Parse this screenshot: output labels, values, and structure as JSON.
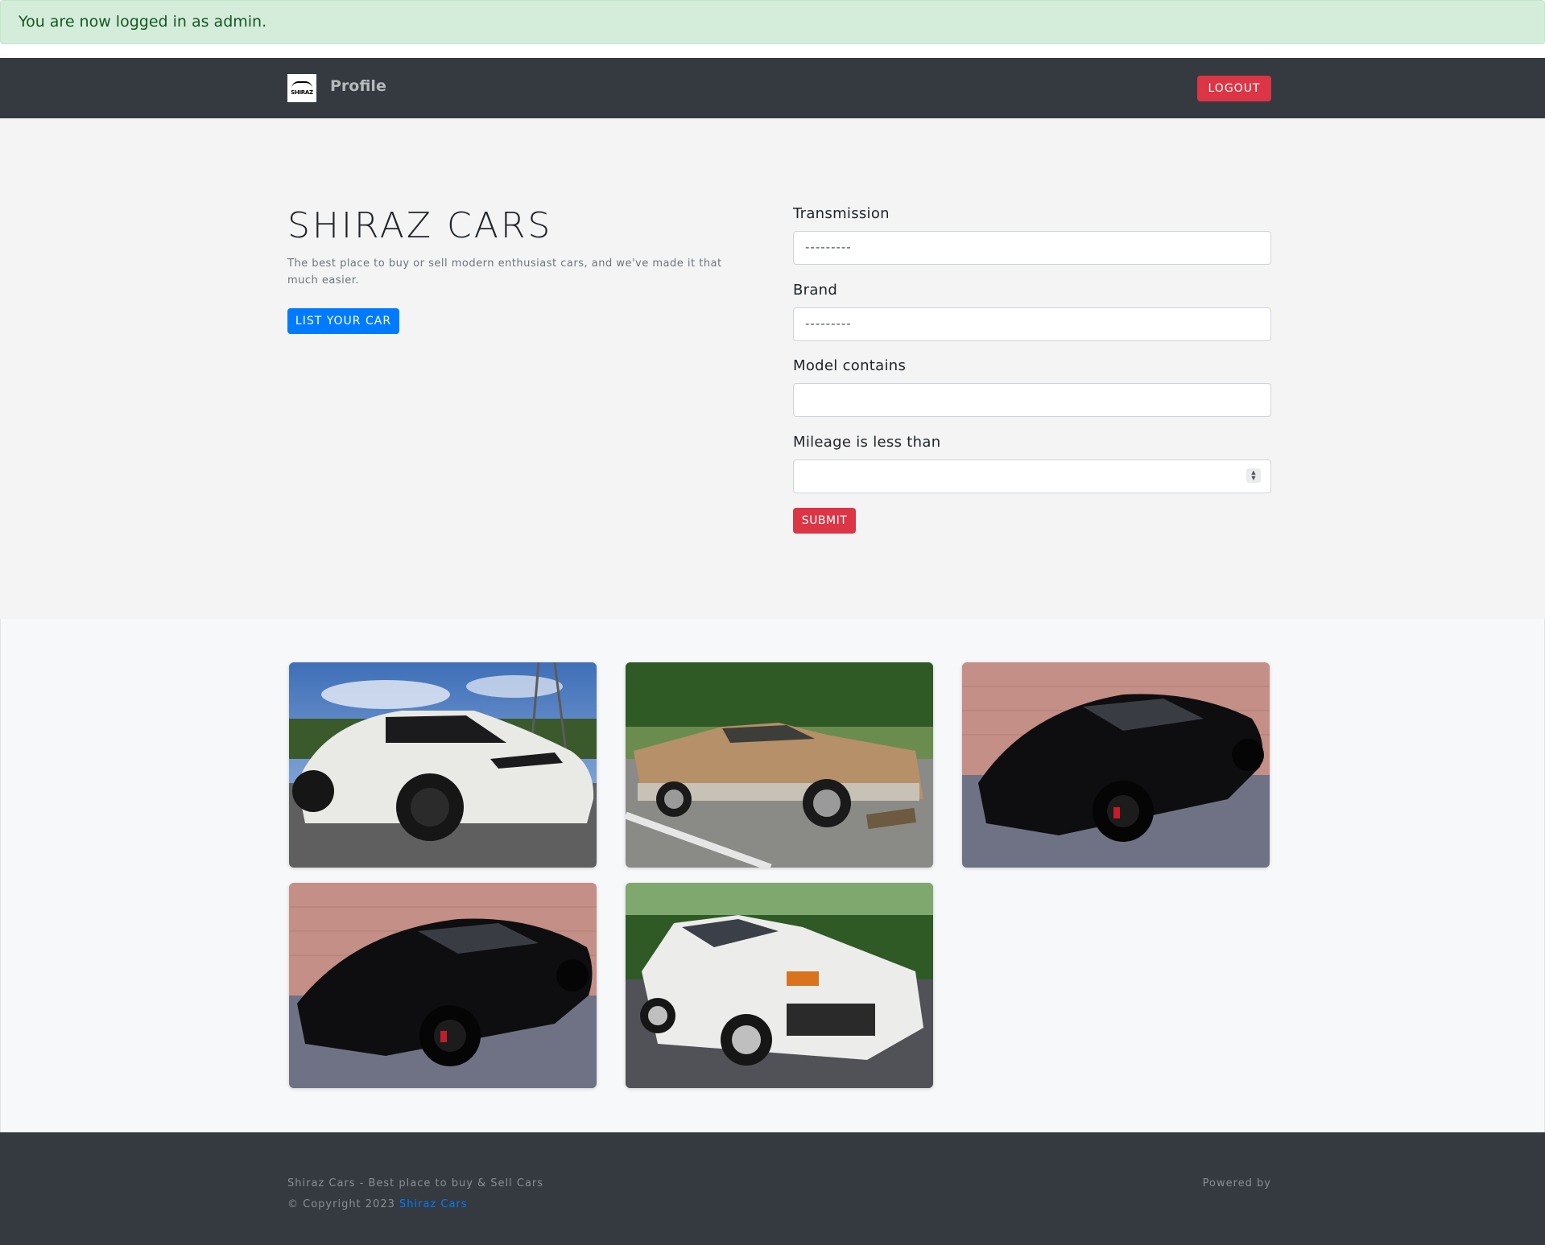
{
  "alert": {
    "message": "You are now logged in as admin."
  },
  "navbar": {
    "logo_text": "SHIRAZ",
    "profile_label": "Profile",
    "logout_label": "LOGOUT"
  },
  "hero": {
    "title": "SHIRAZ CARS",
    "description": "The best place to buy or sell modern enthusiast cars, and we've made it that much easier.",
    "list_button": "LIST YOUR CAR"
  },
  "search_form": {
    "transmission": {
      "label": "Transmission",
      "value": "---------"
    },
    "brand": {
      "label": "Brand",
      "value": "---------"
    },
    "model": {
      "label": "Model contains",
      "value": ""
    },
    "mileage": {
      "label": "Mileage is less than",
      "value": ""
    },
    "submit_label": "SUBMIT"
  },
  "listings": [
    {
      "image": "white-tesla-model-y-photo"
    },
    {
      "image": "tan-el-camino-photo"
    },
    {
      "image": "black-jaguar-f-type-photo"
    },
    {
      "image": "black-jaguar-f-type-photo"
    },
    {
      "image": "white-mitsubishi-evo-photo"
    }
  ],
  "footer": {
    "tagline": "Shiraz Cars - Best place to buy & Sell Cars",
    "copyright_prefix": "© Copyright 2023",
    "copyright_link": "Shiraz Cars",
    "powered_by": "Powered by"
  },
  "colors": {
    "navbar": "#343a40",
    "danger": "#dc3545",
    "primary": "#007bff",
    "alert_bg": "#d4edda",
    "alert_text": "#155724",
    "hero_bg": "#f4f4f4"
  }
}
